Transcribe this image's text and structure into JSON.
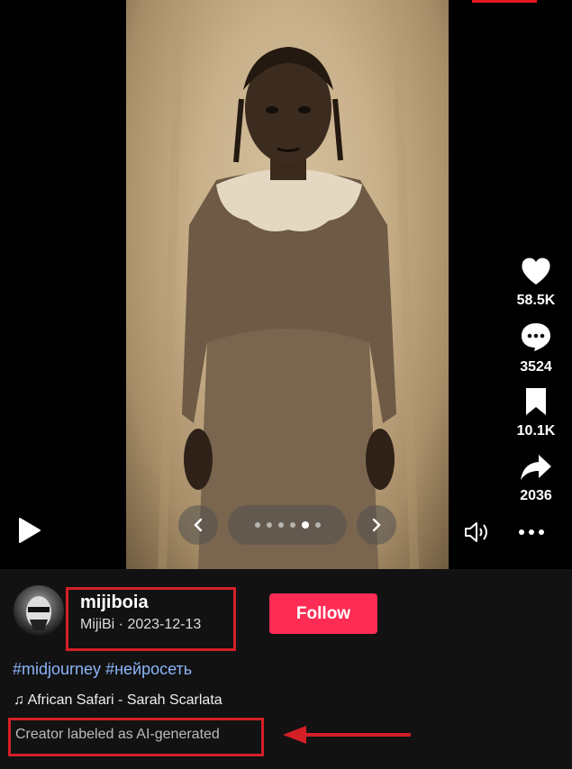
{
  "post": {
    "username": "mijiboia",
    "display_name": "MijiBi",
    "separator": "·",
    "date": "2023-12-13",
    "follow_label": "Follow",
    "hashtags": [
      "#midjourney",
      "#нейросеть"
    ],
    "music_note": "♫",
    "music": "African Safari - Sarah Scarlata",
    "ai_label": "Creator labeled as AI-generated"
  },
  "actions": {
    "likes": "58.5K",
    "comments": "3524",
    "saves": "10.1K",
    "shares": "2036"
  },
  "carousel": {
    "count": 6,
    "active_index": 4
  },
  "colors": {
    "follow": "#fe2c55",
    "annotation": "#d41f27",
    "hashtag": "#8ab4f8"
  }
}
